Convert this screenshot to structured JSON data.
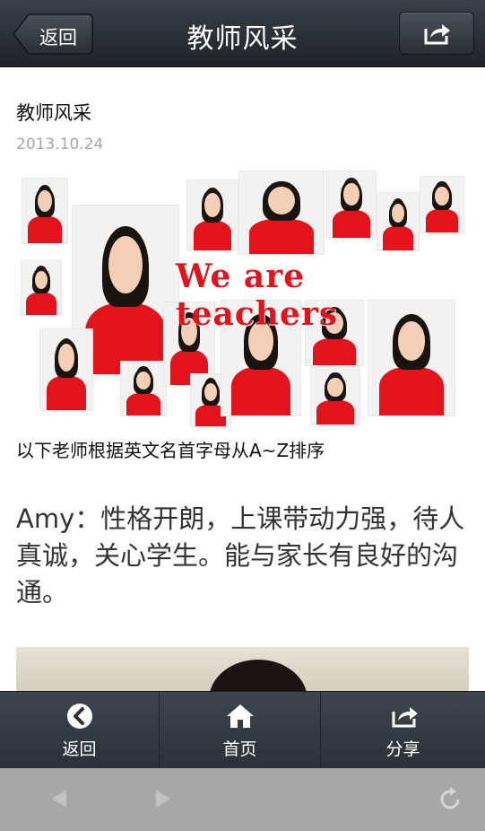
{
  "header": {
    "back_label": "返回",
    "title": "教师风采",
    "share_icon": "share-icon"
  },
  "article": {
    "title": "教师风采",
    "date": "2013.10.24",
    "banner_text": "We are teachers",
    "intro": "以下老师根据英文名首字母从A~Z排序",
    "amy_text": "Amy：性格开朗，上课带动力强，待人真诚，关心学生。能与家长有良好的沟通。"
  },
  "tabbar": {
    "items": [
      {
        "label": "返回",
        "icon": "back-circle-icon"
      },
      {
        "label": "首页",
        "icon": "home-icon"
      },
      {
        "label": "分享",
        "icon": "share-icon"
      }
    ]
  },
  "browser": {
    "back_icon": "browser-back-icon",
    "forward_icon": "browser-forward-icon",
    "reload_icon": "reload-icon"
  },
  "colors": {
    "accent_red": "#e3131b",
    "nav_dark": "#1f2328",
    "date_gray": "#a8a8a8"
  }
}
